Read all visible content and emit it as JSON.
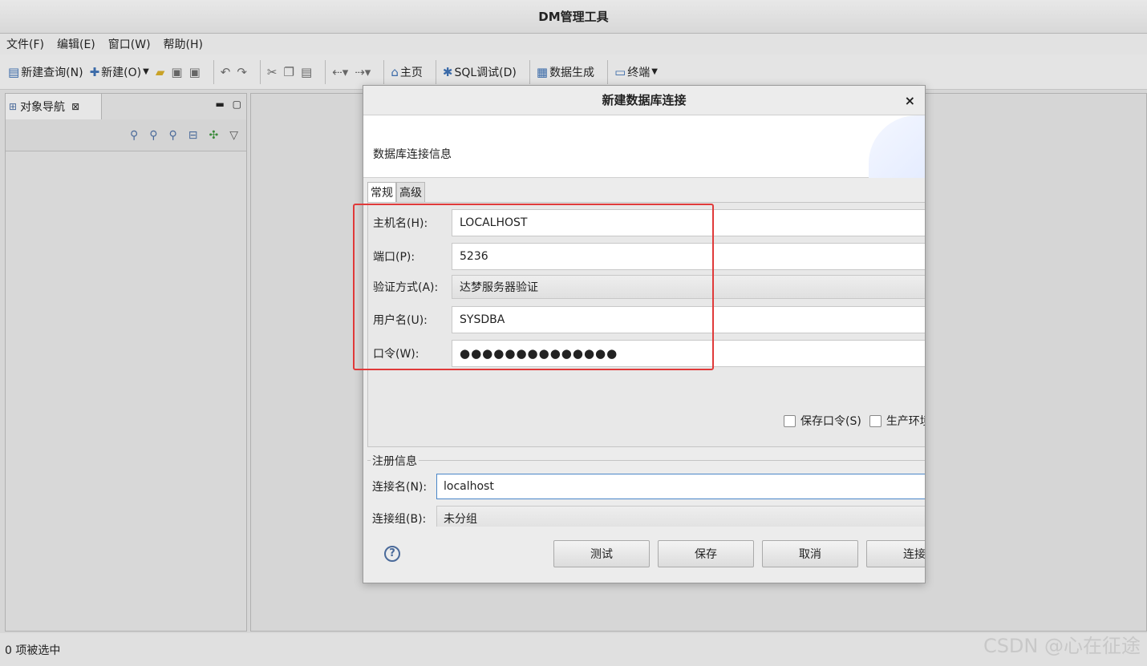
{
  "app": {
    "title": "DM管理工具"
  },
  "menu": {
    "items": [
      "文件(F)",
      "编辑(E)",
      "窗口(W)",
      "帮助(H)"
    ]
  },
  "toolbar": {
    "new_query": "新建查询(N)",
    "new": "新建(O)",
    "home": "主页",
    "sql_debug": "SQL调试(D)",
    "data_gen": "数据生成",
    "terminal": "终端"
  },
  "nav": {
    "tab_label": "对象导航"
  },
  "status": {
    "text": "0 项被选中"
  },
  "watermark": "CSDN @心在征途",
  "dialog": {
    "title": "新建数据库连接",
    "close": "×",
    "banner_text": "数据库连接信息",
    "tabs": [
      "常规",
      "高级"
    ],
    "fields": {
      "host_label": "主机名(H):",
      "host_value": "LOCALHOST",
      "port_label": "端口(P):",
      "port_value": "5236",
      "auth_label": "验证方式(A):",
      "auth_value": "达梦服务器验证",
      "user_label": "用户名(U):",
      "user_value": "SYSDBA",
      "pwd_label": "口令(W):",
      "pwd_value": "●●●●●●●●●●●●●●"
    },
    "checks": {
      "save_pwd": "保存口令(S)",
      "prod_env": "生产环境"
    },
    "register": {
      "title": "注册信息",
      "conn_name_label": "连接名(N):",
      "conn_name_value": "localhost",
      "conn_group_label": "连接组(B):",
      "conn_group_value": "未分组"
    },
    "buttons": {
      "help": "?",
      "test": "测试",
      "save": "保存",
      "cancel": "取消",
      "connect": "连接"
    }
  },
  "colors": {
    "highlight_box": "#e03a3a",
    "focus_border": "#4a86c8"
  }
}
